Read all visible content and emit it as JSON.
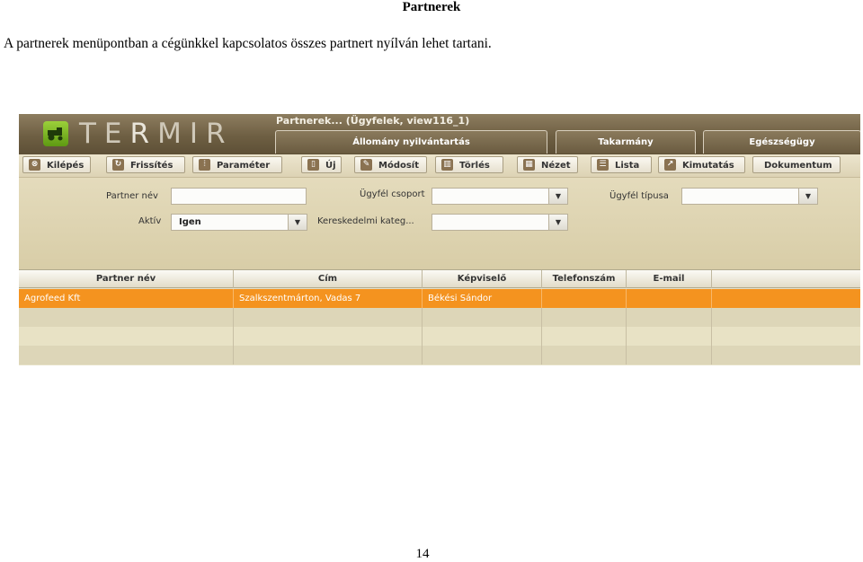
{
  "document": {
    "title": "Partnerek",
    "intro": "A partnerek menüpontban a cégünkkel kapcsolatos összes partnert nyílván lehet tartani.",
    "page_number": "14"
  },
  "app": {
    "logo_text_part1": "TE",
    "logo_text_accent": "R",
    "logo_text_part2": "MIR",
    "window_title": "Partnerek... (Ügyfelek, view116_1)",
    "module_tabs": [
      "Állomány nyilvántartás",
      "Takarmány",
      "Egészségügy"
    ],
    "toolbar": {
      "kilepes": "Kilépés",
      "frissites": "Frissítés",
      "parameter": "Paraméter",
      "uj": "Új",
      "modosit": "Módosít",
      "torles": "Törlés",
      "nezet": "Nézet",
      "lista": "Lista",
      "kimutatas": "Kimutatás",
      "dokumentum": "Dokumentum"
    },
    "filters": {
      "partner_nev_label": "Partner név",
      "partner_nev_value": "",
      "ugyfel_csoport_label": "Ügyfél csoport",
      "ugyfel_csoport_value": "",
      "ugyfel_tipusa_label": "Ügyfél típusa",
      "ugyfel_tipusa_value": "",
      "aktiv_label": "Aktív",
      "aktiv_value": "Igen",
      "keresk_kateg_label": "Kereskedelmi kateg...",
      "keresk_kateg_value": ""
    },
    "grid": {
      "columns": [
        "Partner név",
        "Cím",
        "Képviselő",
        "Telefonszám",
        "E-mail"
      ],
      "rows": [
        [
          "Agrofeed Kft",
          "Szalkszentmárton, Vadas 7",
          "Békési Sándor",
          "",
          ""
        ]
      ]
    },
    "colors": {
      "selected_row": "#f4931f",
      "header_brown": "#6e5f43",
      "logo_green": "#7cb926"
    }
  }
}
